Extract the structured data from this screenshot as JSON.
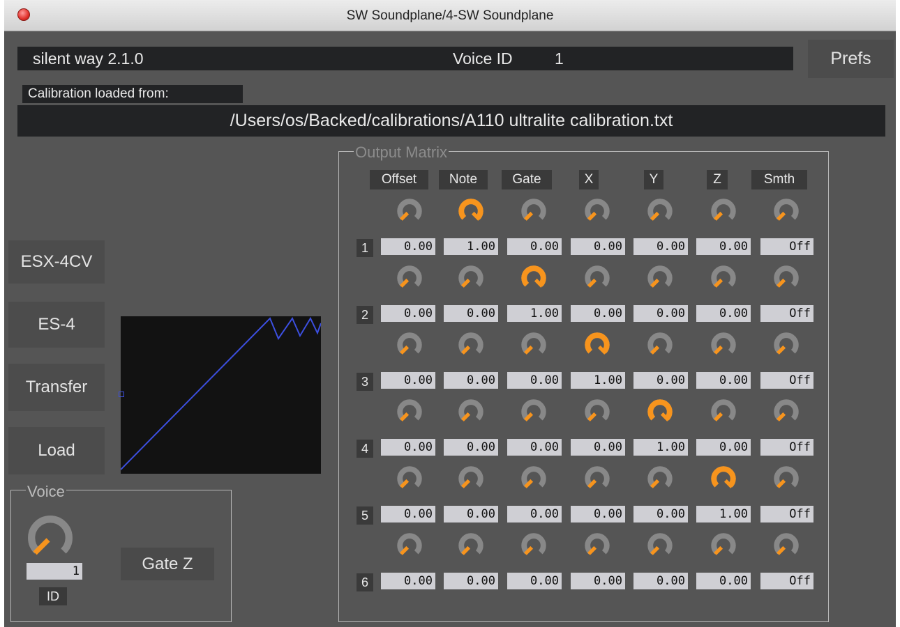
{
  "window": {
    "title": "SW Soundplane/4-SW Soundplane"
  },
  "header": {
    "version": "silent way 2.1.0",
    "voice_id_label": "Voice ID",
    "voice_id_value": "1",
    "prefs_label": "Prefs"
  },
  "calibration": {
    "label": "Calibration loaded from:",
    "path": "/Users/os/Backed/calibrations/A110 ultralite calibration.txt"
  },
  "side_buttons": [
    "ESX-4CV",
    "ES-4",
    "Transfer",
    "Load"
  ],
  "voice": {
    "group_label": "Voice",
    "id_value": "1",
    "id_label": "ID",
    "gate_z_label": "Gate Z",
    "knob_value": 0.0
  },
  "matrix": {
    "group_label": "Output Matrix",
    "columns": [
      "Offset",
      "Note",
      "Gate",
      "X",
      "Y",
      "Z",
      "Smth"
    ],
    "rows": [
      {
        "label": "1",
        "values": [
          "0.00",
          "1.00",
          "0.00",
          "0.00",
          "0.00",
          "0.00",
          "Off"
        ],
        "knobs": [
          0,
          1,
          0,
          0,
          0,
          0,
          0
        ]
      },
      {
        "label": "2",
        "values": [
          "0.00",
          "0.00",
          "1.00",
          "0.00",
          "0.00",
          "0.00",
          "Off"
        ],
        "knobs": [
          0,
          0,
          1,
          0,
          0,
          0,
          0
        ]
      },
      {
        "label": "3",
        "values": [
          "0.00",
          "0.00",
          "0.00",
          "1.00",
          "0.00",
          "0.00",
          "Off"
        ],
        "knobs": [
          0,
          0,
          0,
          1,
          0,
          0,
          0
        ]
      },
      {
        "label": "4",
        "values": [
          "0.00",
          "0.00",
          "0.00",
          "0.00",
          "1.00",
          "0.00",
          "Off"
        ],
        "knobs": [
          0,
          0,
          0,
          0,
          1,
          0,
          0
        ]
      },
      {
        "label": "5",
        "values": [
          "0.00",
          "0.00",
          "0.00",
          "0.00",
          "0.00",
          "1.00",
          "Off"
        ],
        "knobs": [
          0,
          0,
          0,
          0,
          0,
          1,
          0
        ]
      },
      {
        "label": "6",
        "values": [
          "0.00",
          "0.00",
          "0.00",
          "0.00",
          "0.00",
          "0.00",
          "Off"
        ],
        "knobs": [
          0,
          0,
          0,
          0,
          0,
          0,
          0
        ]
      }
    ]
  },
  "colors": {
    "window_bg": "#555555",
    "dark_field": "#222325",
    "knob_orange": "#f7941d",
    "knob_track": "#888888",
    "graph_line": "#3c4fe0",
    "value_box": "#cfcfd4"
  },
  "icons": {
    "knob": "rotary-knob-icon",
    "close": "close-icon"
  }
}
